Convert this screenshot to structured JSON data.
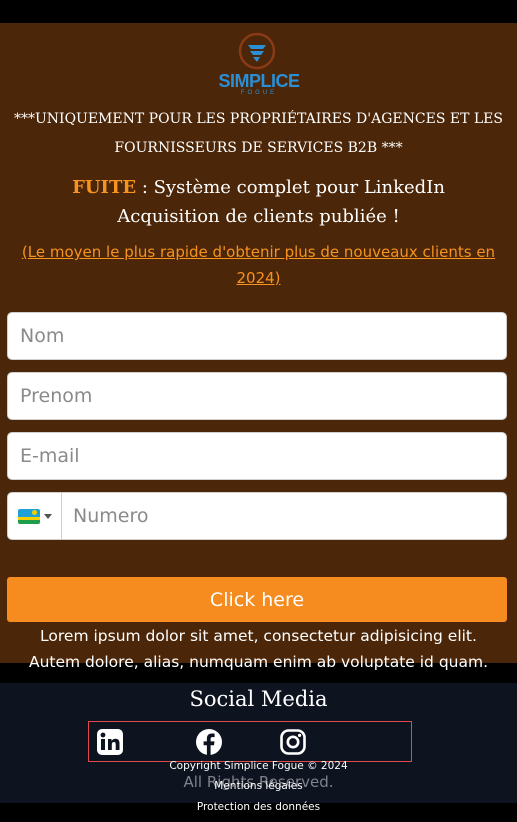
{
  "brand": {
    "name": "SIMPLICE",
    "sub": "FOGUE"
  },
  "disclaimer": {
    "line1": "***UNIQUEMENT POUR LES PROPRIÉTAIRES D'AGENCES ET LES",
    "line2": "FOURNISSEURS DE SERVICES B2B ***"
  },
  "headline": {
    "accent": "FUITE",
    "rest_line1": " : Système complet pour LinkedIn",
    "line2": "Acquisition de clients publiée !"
  },
  "subline": {
    "line1": "(Le moyen le plus rapide d'obtenir plus de nouveaux clients en",
    "line2": "2024)"
  },
  "form": {
    "nom_placeholder": "Nom",
    "prenom_placeholder": "Prenom",
    "email_placeholder": "E-mail",
    "numero_placeholder": "Numero",
    "submit_label": "Click here"
  },
  "lorem": {
    "line1": "Lorem ipsum dolor sit amet, consectetur adipisicing elit.",
    "line2": "Autem dolore, alias, numquam enim ab voluptate id quam."
  },
  "footer": {
    "social_title": "Social Media",
    "icons": [
      "linkedin-icon",
      "facebook-icon",
      "instagram-icon"
    ],
    "copyright": "Copyright Simplice Fogue © 2024",
    "rights": "All Rights Reserved.",
    "mentions": "Mentions légales",
    "protection": "Protection des données"
  },
  "colors": {
    "hero_bg": "#4b2608",
    "accent": "#f68b1f",
    "footer_bg": "#0e1320",
    "brand_blue": "#2b8fd6"
  }
}
